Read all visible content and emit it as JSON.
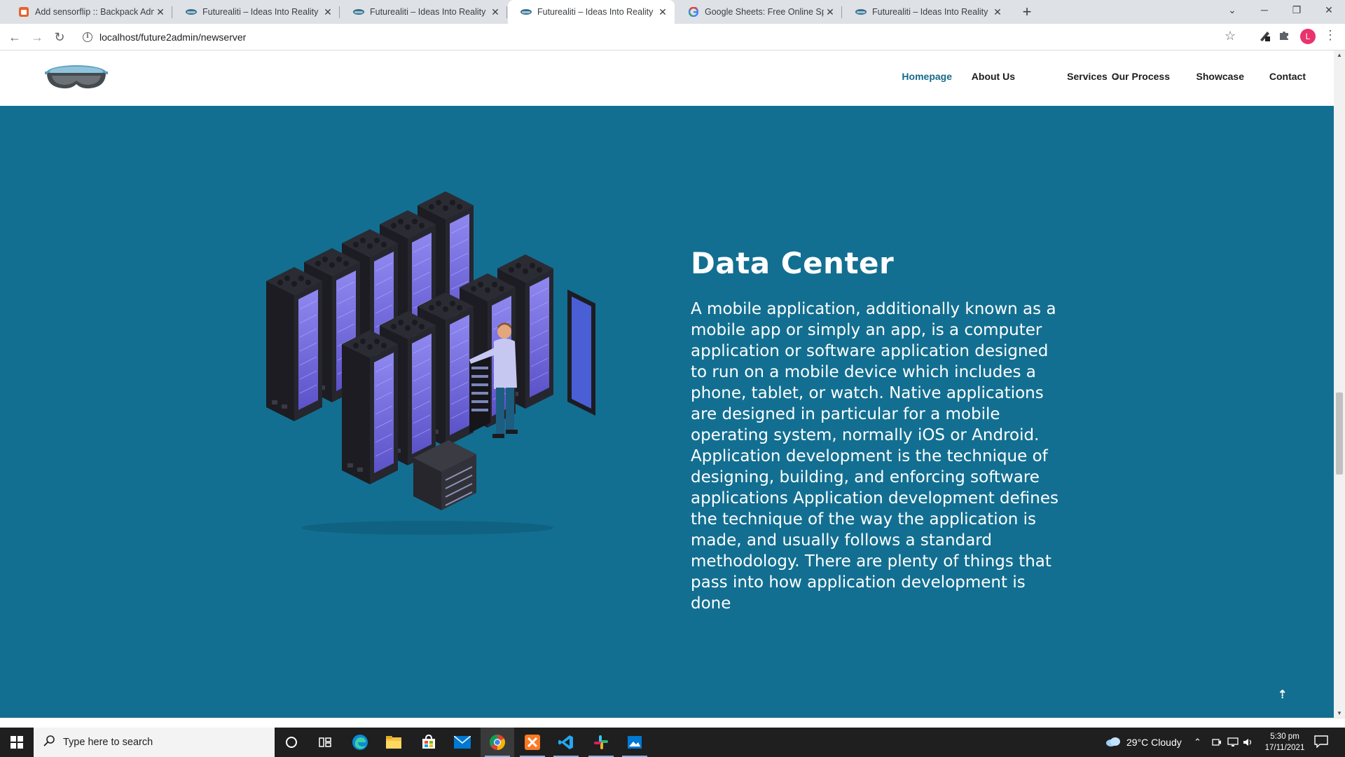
{
  "browser": {
    "tabs": [
      {
        "title": "Add sensorflip :: Backpack Admin",
        "favicon": "backpack-icon",
        "active": false
      },
      {
        "title": "Futurealiti – Ideas Into Reality",
        "favicon": "futurealiti-icon",
        "active": false
      },
      {
        "title": "Futurealiti – Ideas Into Reality",
        "favicon": "futurealiti-icon",
        "active": false
      },
      {
        "title": "Futurealiti – Ideas Into Reality",
        "favicon": "futurealiti-icon",
        "active": true
      },
      {
        "title": "Google Sheets: Free Online Spreadsheet",
        "favicon": "google-icon",
        "active": false
      },
      {
        "title": "Futurealiti – Ideas Into Reality",
        "favicon": "futurealiti-icon",
        "active": false
      }
    ],
    "url": "localhost/future2admin/newserver",
    "profile_initial": "L"
  },
  "site": {
    "nav": [
      {
        "label": "Homepage",
        "active": true
      },
      {
        "label": "About Us",
        "active": false
      },
      {
        "label": "Services",
        "active": false,
        "has_dropdown": true
      },
      {
        "label": "Our Process",
        "active": false
      },
      {
        "label": "Showcase",
        "active": false
      },
      {
        "label": "Contact",
        "active": false
      }
    ],
    "section": {
      "title": "Data Center",
      "body": "A mobile application, additionally known as a mobile app or simply an app, is a computer application or software application designed to run on a mobile device which includes a phone, tablet, or watch. Native applications are designed in particular for a mobile operating system, normally iOS or Android. Application development is the technique of designing, building, and enforcing software applications Application development defines the technique of the way the application is made, and usually follows a standard methodology. There are plenty of things that pass into how application development is done"
    },
    "back_to_top_glyph": "⇡",
    "colors": {
      "hero_bg": "#126f91",
      "nav_active": "#16698a"
    }
  },
  "taskbar": {
    "search_placeholder": "Type here to search",
    "apps": [
      "cortana-icon",
      "task-view-icon",
      "edge-icon",
      "file-explorer-icon",
      "store-icon",
      "mail-icon",
      "chrome-icon",
      "xampp-icon",
      "vscode-icon",
      "slack-icon",
      "photos-icon"
    ],
    "weather": "29°C  Cloudy",
    "time": "5:30 pm",
    "date": "17/11/2021"
  }
}
